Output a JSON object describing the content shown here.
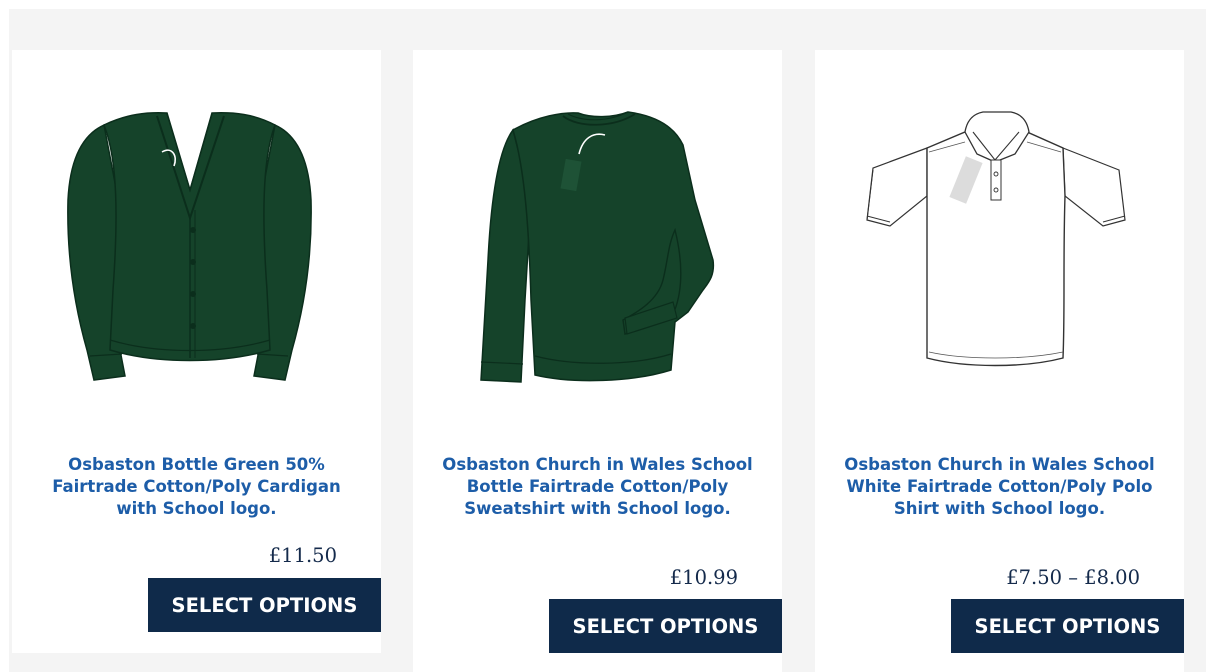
{
  "products": [
    {
      "title": "Osbaston Bottle Green 50% Fairtrade Cotton/Poly Cardigan with School logo.",
      "price": "£11.50",
      "button_label": "SELECT OPTIONS",
      "image": "green-cardigan-image",
      "color": "#15432a"
    },
    {
      "title": "Osbaston Church in Wales School Bottle Fairtrade Cotton/Poly Sweatshirt with School logo.",
      "price": "£10.99",
      "button_label": "SELECT OPTIONS",
      "image": "green-sweatshirt-image",
      "color": "#15432a"
    },
    {
      "title": "Osbaston Church in Wales School White Fairtrade Cotton/Poly Polo Shirt with School logo.",
      "price": "£7.50 – £8.00",
      "button_label": "SELECT OPTIONS",
      "image": "white-polo-shirt-image",
      "color": "#ffffff"
    }
  ],
  "colors": {
    "title": "#1d5da8",
    "price": "#142a4b",
    "button_bg": "#0f2a4a",
    "background": "#f4f4f4"
  }
}
